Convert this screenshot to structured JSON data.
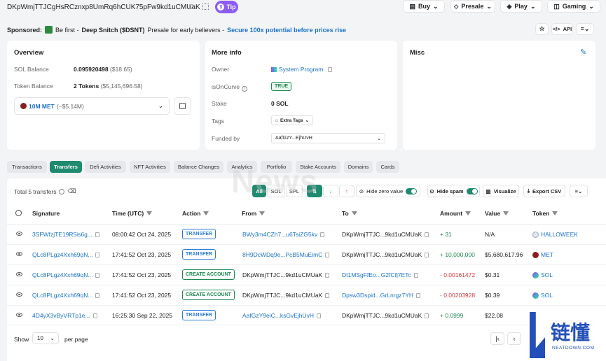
{
  "header": {
    "address": "DKpWmjTTJCgHsRCznxp8UmRq6hCUK75pFw9kd1uCMUaK",
    "tip_label": "Tip",
    "menu": [
      {
        "label": "Buy"
      },
      {
        "label": "Presale"
      },
      {
        "label": "Play"
      },
      {
        "label": "Gaming"
      }
    ]
  },
  "sponsor": {
    "label": "Sponsored:",
    "lead": "Be first -",
    "name": "Deep Snitch ($DSNT)",
    "text": "Presale for early believers -",
    "cta": "Secure 100x potential before prices rise",
    "api_label": "API"
  },
  "overview": {
    "title": "Overview",
    "sol_balance_label": "SOL Balance",
    "sol_balance": "0.095920498",
    "sol_usd": "($18.65)",
    "token_balance_label": "Token Balance",
    "token_balance": "2 Tokens",
    "token_usd": "($5,145,696.58)",
    "token_select": "10M MET",
    "token_select_usd": "(~$5.14M)"
  },
  "more_info": {
    "title": "More info",
    "owner_label": "Owner",
    "owner": "System Program",
    "curve_label": "isOnCurve",
    "curve": "TRUE",
    "stake_label": "Stake",
    "stake": "0 SOL",
    "tags_label": "Tags",
    "tags": "Extra Tags",
    "funded_label": "Funded by",
    "funded": "AafGzY...EjhUvH"
  },
  "misc": {
    "title": "Misc"
  },
  "tabs": [
    {
      "label": "Transactions"
    },
    {
      "label": "Transfers"
    },
    {
      "label": "Defi Activities"
    },
    {
      "label": "NFT Activities"
    },
    {
      "label": "Balance Changes"
    },
    {
      "label": "Analytics"
    },
    {
      "label": "Portfolio"
    },
    {
      "label": "Stake Accounts"
    },
    {
      "label": "Domains"
    },
    {
      "label": "Cards"
    }
  ],
  "toolbar": {
    "total": "Total 5 transfers",
    "all": "All",
    "sol": "SOL",
    "spl": "SPL",
    "hide_zero": "Hide zero value",
    "hide_spam": "Hide spam",
    "visualize": "Visualize",
    "export": "Export CSV"
  },
  "columns": {
    "signature": "Signature",
    "time": "Time (UTC)",
    "action": "Action",
    "from": "From",
    "to": "To",
    "amount": "Amount",
    "value": "Value",
    "token": "Token"
  },
  "rows": [
    {
      "sig": "3SFWfzjTE19R5is6g...",
      "time": "08:00:42 Oct 24, 2025",
      "action": "TRANSFER",
      "from": "BWy3m4CZh7...u6TsiZG5kv",
      "to": "DKpWmjTTJC...9kd1uCMUaK",
      "amount": "+ 31",
      "value": "N/A",
      "token": "HALLOWEEK"
    },
    {
      "sig": "QLc8PLgz4Xxh69qN...",
      "time": "17:41:52 Oct 23, 2025",
      "action": "TRANSFER",
      "from": "8H9DcWDq9e...PcB5MuEimC",
      "to": "DKpWmjTTJC...9kd1uCMUaK",
      "amount": "+ 10,000,000",
      "value": "$5,680,617.96",
      "token": "MET"
    },
    {
      "sig": "QLc8PLgz4Xxh69qN...",
      "time": "17:41:52 Oct 23, 2025",
      "action": "CREATE ACCOUNT",
      "from": "DKpWmjTTJC...9kd1uCMUaK",
      "to": "Dt1MSgFfEo...G2fCfj7ETc",
      "amount": "- 0.00161472",
      "value": "$0.31",
      "token": "SOL"
    },
    {
      "sig": "QLc8PLgz4Xxh69qN...",
      "time": "17:41:52 Oct 23, 2025",
      "action": "CREATE ACCOUNT",
      "from": "DKpWmjTTJC...9kd1uCMUaK",
      "to": "Dpsw3Dspid...GrLnrgz7YH",
      "amount": "- 0.00203928",
      "value": "$0.39",
      "token": "SOL"
    },
    {
      "sig": "4D4yX3vByVRTp1e...",
      "time": "16:25:30 Sep 22, 2025",
      "action": "TRANSFER",
      "from": "AafGzY9eiC...ksGvEjhUvH",
      "to": "DKpWmjTTJC...9kd1uCMUaK",
      "amount": "+ 0.0999",
      "value": "$22.08",
      "token": ""
    }
  ],
  "pager": {
    "show": "Show",
    "size": "10",
    "per_page": "per page"
  },
  "watermark": {
    "cn": "链懂",
    "en": "NEATDOWN.COM",
    "news": "News"
  },
  "colors": {
    "accent": "#1f8a70",
    "link": "#1a73c9",
    "positive": "#1f8a50",
    "negative": "#d2383c",
    "tip": "#8b5cf6"
  }
}
